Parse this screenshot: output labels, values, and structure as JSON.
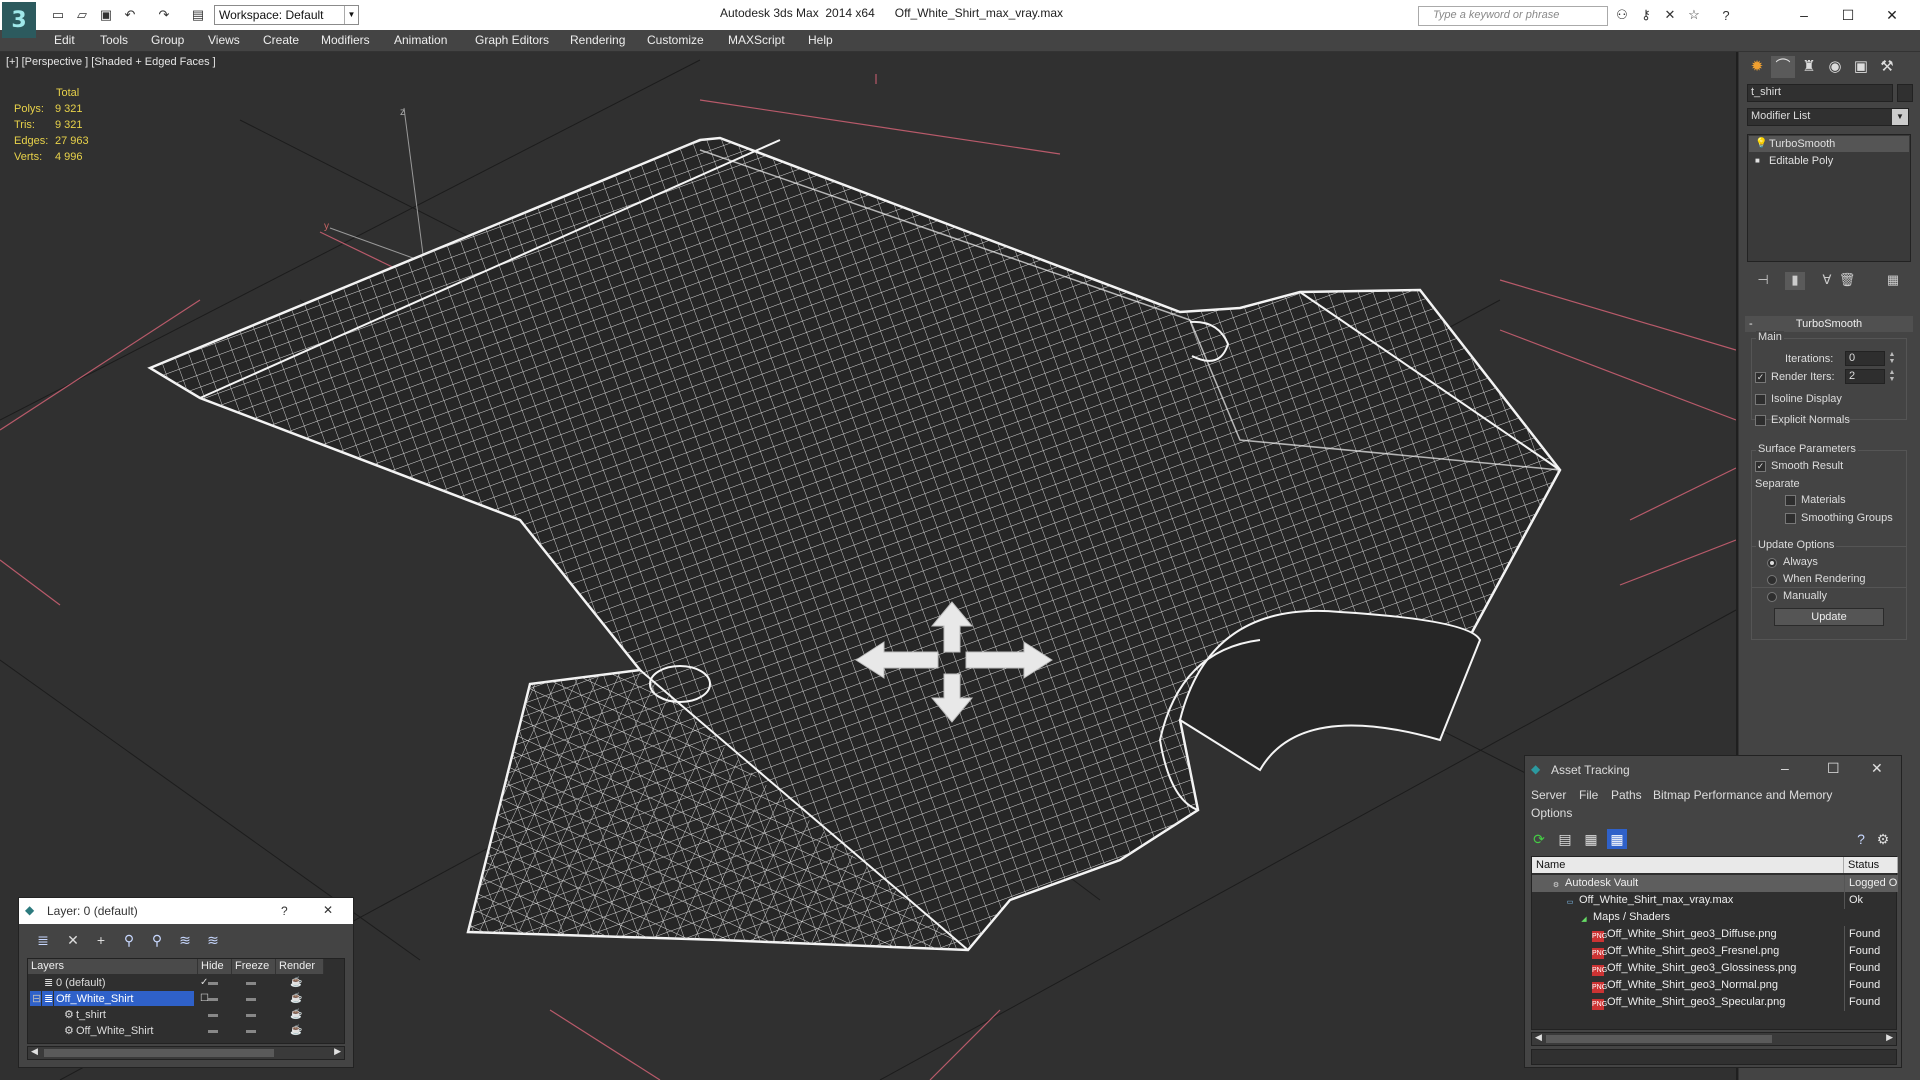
{
  "titlebar": {
    "app_title": "Autodesk 3ds Max  2014 x64      Off_White_Shirt_max_vray.max",
    "workspace": "Workspace: Default",
    "search_placeholder": "Type a keyword or phrase",
    "minimize": "–",
    "maximize": "☐",
    "close": "✕"
  },
  "menu": [
    "Edit",
    "Tools",
    "Group",
    "Views",
    "Create",
    "Modifiers",
    "Animation",
    "Graph Editors",
    "Rendering",
    "Customize",
    "MAXScript",
    "Help"
  ],
  "viewport": {
    "label": "[+] [Perspective ] [Shaded + Edged Faces ]",
    "stats": {
      "header": "Total",
      "polys_label": "Polys:",
      "polys": "9 321",
      "tris_label": "Tris:",
      "tris": "9 321",
      "edges_label": "Edges:",
      "edges": "27 963",
      "verts_label": "Verts:",
      "verts": "4 996"
    },
    "axis": {
      "z": "z",
      "y": "y"
    }
  },
  "command_panel": {
    "object_name": "t_shirt",
    "modifier_list": "Modifier List",
    "stack": [
      "TurboSmooth",
      "Editable Poly"
    ],
    "rollout_title": "TurboSmooth",
    "main_group": "Main",
    "iterations_label": "Iterations:",
    "iterations_value": "0",
    "render_iters_label": "Render Iters:",
    "render_iters_value": "2",
    "render_iters_checked": true,
    "isoline_label": "Isoline Display",
    "explicit_normals_label": "Explicit Normals",
    "surface_group": "Surface Parameters",
    "smooth_result_label": "Smooth Result",
    "separate_label": "Separate",
    "materials_label": "Materials",
    "smoothing_groups_label": "Smoothing Groups",
    "update_group": "Update Options",
    "always_label": "Always",
    "when_rendering_label": "When Rendering",
    "manually_label": "Manually",
    "update_button": "Update"
  },
  "layer_dialog": {
    "title": "Layer: 0 (default)",
    "help": "?",
    "close": "✕",
    "headers": [
      "Layers",
      "Hide",
      "Freeze",
      "Render"
    ],
    "rows": [
      {
        "name": "0 (default)",
        "indent": 0,
        "selected": false,
        "active": "✓"
      },
      {
        "name": "Off_White_Shirt",
        "indent": 0,
        "selected": true,
        "active": ""
      },
      {
        "name": "t_shirt",
        "indent": 1,
        "selected": false,
        "active": ""
      },
      {
        "name": "Off_White_Shirt",
        "indent": 1,
        "selected": false,
        "active": ""
      }
    ]
  },
  "asset_tracking": {
    "title": "Asset Tracking",
    "menus": [
      "Server",
      "File",
      "Paths",
      "Bitmap Performance and Memory",
      "Options"
    ],
    "headers": [
      "Name",
      "Status"
    ],
    "rows": [
      {
        "name": "Autodesk Vault",
        "status": "Logged O",
        "indent": 0,
        "icon": "vault"
      },
      {
        "name": "Off_White_Shirt_max_vray.max",
        "status": "Ok",
        "indent": 1,
        "icon": "max"
      },
      {
        "name": "Maps / Shaders",
        "status": "",
        "indent": 2,
        "icon": "folder"
      },
      {
        "name": "Off_White_Shirt_geo3_Diffuse.png",
        "status": "Found",
        "indent": 3,
        "icon": "png"
      },
      {
        "name": "Off_White_Shirt_geo3_Fresnel.png",
        "status": "Found",
        "indent": 3,
        "icon": "png"
      },
      {
        "name": "Off_White_Shirt_geo3_Glossiness.png",
        "status": "Found",
        "indent": 3,
        "icon": "png"
      },
      {
        "name": "Off_White_Shirt_geo3_Normal.png",
        "status": "Found",
        "indent": 3,
        "icon": "png"
      },
      {
        "name": "Off_White_Shirt_geo3_Specular.png",
        "status": "Found",
        "indent": 3,
        "icon": "png"
      }
    ]
  },
  "colors": {
    "accent_blue": "#2f61c9",
    "stats_yellow": "#e8d24a",
    "grid_red": "#c86464"
  }
}
